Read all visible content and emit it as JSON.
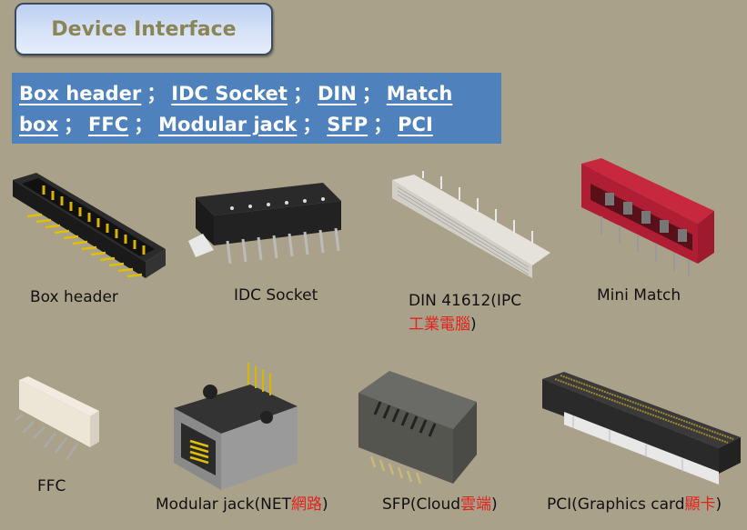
{
  "title": "Device Interface",
  "links": {
    "items": [
      "Box header",
      "IDC Socket",
      "DIN",
      "Match box",
      "FFC",
      "Modular jack",
      "SFP",
      "PCI"
    ],
    "separator": "；"
  },
  "products": [
    {
      "label": "Box header"
    },
    {
      "label": "IDC Socket"
    },
    {
      "label": "DIN 41612(IPC",
      "label_red": "工業電腦",
      "label_end": ")"
    },
    {
      "label": "Mini Match"
    },
    {
      "label": "FFC"
    },
    {
      "label": "Modular jack(NET",
      "label_red": "網路",
      "label_end": ")"
    },
    {
      "label": "SFP(Cloud",
      "label_red": "雲端",
      "label_end": ")"
    },
    {
      "label": "PCI(Graphics card",
      "label_red": "顯卡",
      "label_end": ")"
    }
  ],
  "colors": {
    "background": "#a9a18a",
    "link_box": "#4f81bd",
    "title_text": "#8b8556",
    "accent_red": "#e0231c"
  }
}
